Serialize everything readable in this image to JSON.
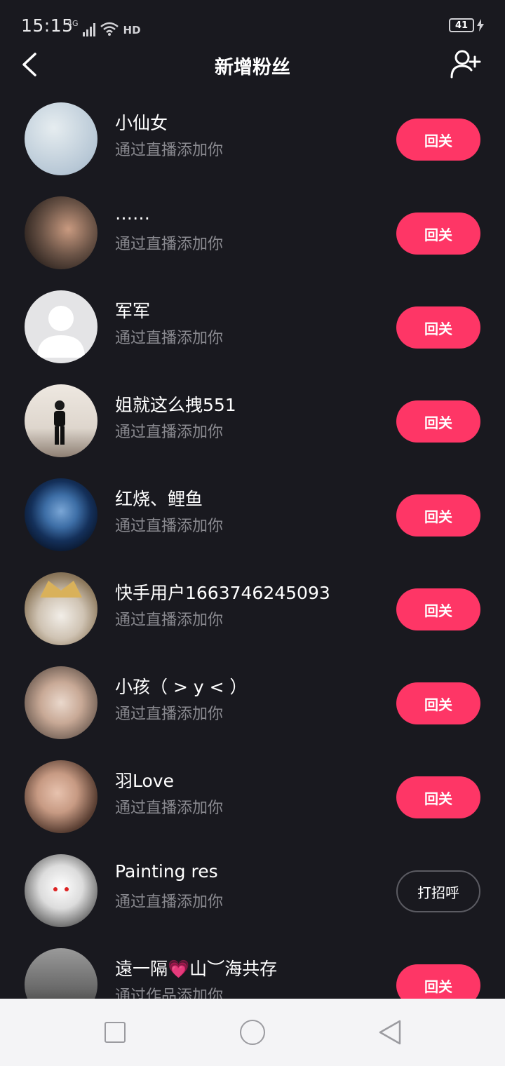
{
  "status_bar": {
    "time": "15:15",
    "network": "4G",
    "hd_label": "HD",
    "battery": "41"
  },
  "header": {
    "title": "新增粉丝"
  },
  "followers": [
    {
      "name": "小仙女",
      "source": "通过直播添加你",
      "action": "回关",
      "action_style": "filled",
      "avatar_colors": [
        "#dfe7ea",
        "#b8c8d6"
      ]
    },
    {
      "name": "……",
      "source": "通过直播添加你",
      "action": "回关",
      "action_style": "filled",
      "avatar_colors": [
        "#6a5346",
        "#2b221e"
      ]
    },
    {
      "name": "军军",
      "source": "通过直播添加你",
      "action": "回关",
      "action_style": "filled",
      "avatar_colors": [
        "#e4e4e6",
        "#e4e4e6"
      ]
    },
    {
      "name": "姐就这么拽551",
      "source": "通过直播添加你",
      "action": "回关",
      "action_style": "filled",
      "avatar_colors": [
        "#ece6df",
        "#b9b0a8"
      ]
    },
    {
      "name": "红烧、鲤鱼",
      "source": "通过直播添加你",
      "action": "回关",
      "action_style": "filled",
      "avatar_colors": [
        "#3d6ea6",
        "#0b1a33"
      ]
    },
    {
      "name": "快手用户1663746245093",
      "source": "通过直播添加你",
      "action": "回关",
      "action_style": "filled",
      "avatar_colors": [
        "#d9b15a",
        "#7d6a4e"
      ]
    },
    {
      "name": "小孩（ > y < ）",
      "source": "通过直播添加你",
      "action": "回关",
      "action_style": "filled",
      "avatar_colors": [
        "#d8c2b4",
        "#6b5a50"
      ]
    },
    {
      "name": "羽Love",
      "source": "通过直播添加你",
      "action": "回关",
      "action_style": "filled",
      "avatar_colors": [
        "#c79a83",
        "#3a2a24"
      ]
    },
    {
      "name": "Painting res",
      "source": "通过直播添加你",
      "action": "打招呼",
      "action_style": "outline",
      "avatar_colors": [
        "#f0f0f0",
        "#3a3a3a"
      ]
    },
    {
      "name": "遠一隔💗山︶海共存",
      "source": "通过作品添加你",
      "action": "回关",
      "action_style": "filled",
      "avatar_colors": [
        "#8a8a8a",
        "#2a2a2a"
      ]
    }
  ],
  "colors": {
    "background": "#19191f",
    "accent": "#fe3666",
    "secondary_text": "#8a8a90"
  },
  "icons": {
    "back": "chevron-left-icon",
    "add_user": "add-user-icon",
    "nav_recent": "square-icon",
    "nav_home": "circle-icon",
    "nav_back": "triangle-back-icon"
  }
}
